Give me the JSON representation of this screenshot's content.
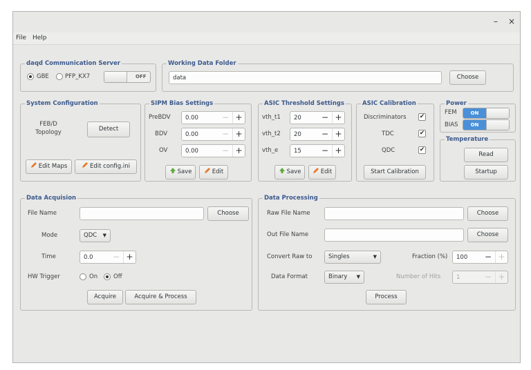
{
  "window": {
    "minimize": "–",
    "close": "×"
  },
  "menu": [
    "File",
    "Help"
  ],
  "comm": {
    "title": "daqd Communication Server",
    "gbe": "GBE",
    "pfp": "PFP_KX7",
    "switch": "OFF"
  },
  "folder": {
    "title": "Working Data Folder",
    "value": "data",
    "choose": "Choose"
  },
  "sysconf": {
    "title": "System Configuration",
    "topology_label": "FEB/D\nTopology",
    "detect": "Detect",
    "edit_maps": "Edit Maps",
    "edit_config": "Edit config.ini"
  },
  "sipm": {
    "title": "SIPM Bias Settings",
    "rows": [
      {
        "label": "PreBDV",
        "value": "0.00"
      },
      {
        "label": "BDV",
        "value": "0.00"
      },
      {
        "label": "OV",
        "value": "0.00"
      }
    ],
    "save": "Save",
    "edit": "Edit"
  },
  "asic_thr": {
    "title": "ASIC Threshold Settings",
    "rows": [
      {
        "label": "vth_t1",
        "value": "20"
      },
      {
        "label": "vth_t2",
        "value": "20"
      },
      {
        "label": "vth_e",
        "value": "15"
      }
    ],
    "save": "Save",
    "edit": "Edit"
  },
  "asic_cal": {
    "title": "ASIC Calibration",
    "items": [
      "Discriminators",
      "TDC",
      "QDC"
    ],
    "start": "Start Calibration"
  },
  "power": {
    "title": "Power",
    "fem": "FEM",
    "bias": "BIAS",
    "fem_state": "ON",
    "bias_state": "ON"
  },
  "temperature": {
    "title": "Temperature",
    "read": "Read",
    "startup": "Startup"
  },
  "acq": {
    "title": "Data Acquision",
    "file_label": "File Name",
    "choose": "Choose",
    "mode_label": "Mode",
    "mode_value": "QDC",
    "time_label": "Time",
    "time_value": "0.0",
    "hw_label": "HW Trigger",
    "on": "On",
    "off": "Off",
    "acquire": "Acquire",
    "acquire_process": "Acquire & Process"
  },
  "proc": {
    "title": "Data Processing",
    "raw_label": "Raw File Name",
    "out_label": "Out File Name",
    "choose": "Choose",
    "convert_label": "Convert Raw to",
    "convert_value": "Singles",
    "fraction_label": "Fraction (%)",
    "fraction_value": "100",
    "format_label": "Data Format",
    "format_value": "Binary",
    "hits_label": "Number of Hits",
    "hits_value": "1",
    "process": "Process"
  },
  "icons": {
    "edit": "pencil-icon",
    "save": "save-icon"
  }
}
